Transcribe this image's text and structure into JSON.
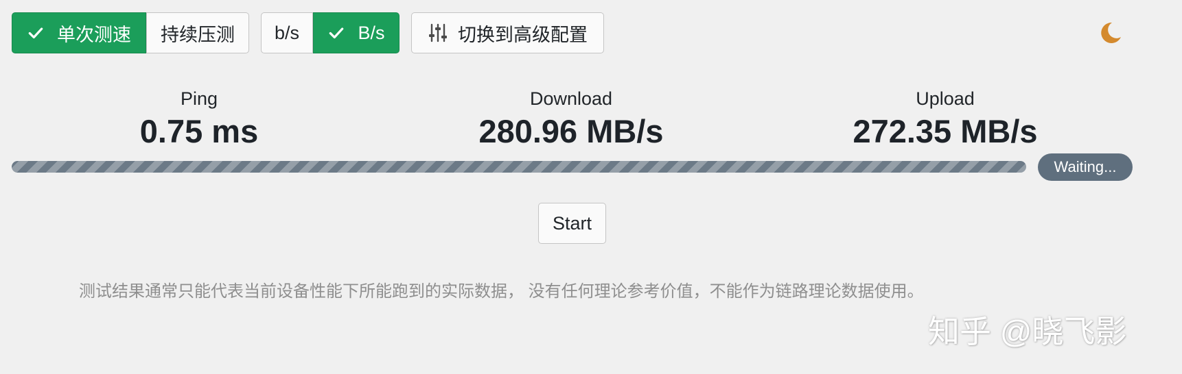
{
  "toolbar": {
    "mode_group": {
      "single_label": "单次测速",
      "continuous_label": "持续压测",
      "active": "single"
    },
    "unit_group": {
      "bits_label": "b/s",
      "bytes_label": "B/s",
      "active": "bytes"
    },
    "advanced_label": "切换到高级配置"
  },
  "metrics": {
    "ping": {
      "label": "Ping",
      "value": "0.75 ms"
    },
    "download": {
      "label": "Download",
      "value": "280.96 MB/s"
    },
    "upload": {
      "label": "Upload",
      "value": "272.35 MB/s"
    }
  },
  "progress": {
    "fraction": 1.0,
    "status": "Waiting..."
  },
  "start_label": "Start",
  "notice": "测试结果通常只能代表当前设备性能下所能跑到的实际数据， 没有任何理论参考价值，不能作为链路理论数据使用。",
  "watermark": "知乎 @晓飞影",
  "icons": {
    "check": "check-icon",
    "sliders": "sliders-icon",
    "theme": "moon-icon"
  },
  "colors": {
    "active": "#1b9e5a",
    "progress": "#6c7a87",
    "moon": "#d48a2e"
  }
}
